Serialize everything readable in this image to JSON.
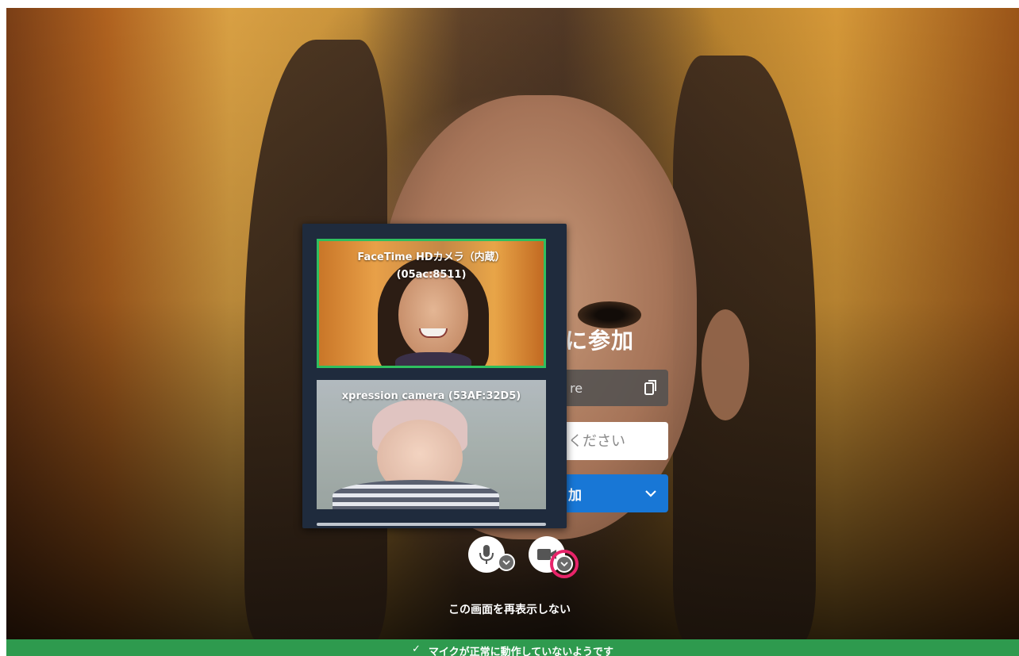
{
  "join": {
    "title_fragment": "に参加",
    "link_fragment": "re",
    "name_placeholder_fragment": "ください",
    "join_button_fragment": "加"
  },
  "camera_menu": {
    "cameras": [
      {
        "label_line1": "FaceTime HDカメラ（内蔵）",
        "label_line2": "(05ac:8511)",
        "selected": true
      },
      {
        "label_line1": "xpression camera (53AF:32D5)",
        "label_line2": "",
        "selected": false
      }
    ]
  },
  "controls": {
    "mic_icon": "microphone-icon",
    "camera_icon": "video-camera-icon",
    "dropdown_icon": "chevron-down-icon"
  },
  "footer": {
    "dont_show_again": "この画面を再表示しない"
  },
  "status_bar": {
    "check_icon": "✓",
    "message": "マイクが正常に動作していないようです"
  },
  "colors": {
    "status_green": "#2e9a4e",
    "join_blue": "#1877d6",
    "selected_border": "#2fbf5f",
    "highlight_ring": "#e8246a",
    "panel_bg": "#1f2b3d"
  }
}
